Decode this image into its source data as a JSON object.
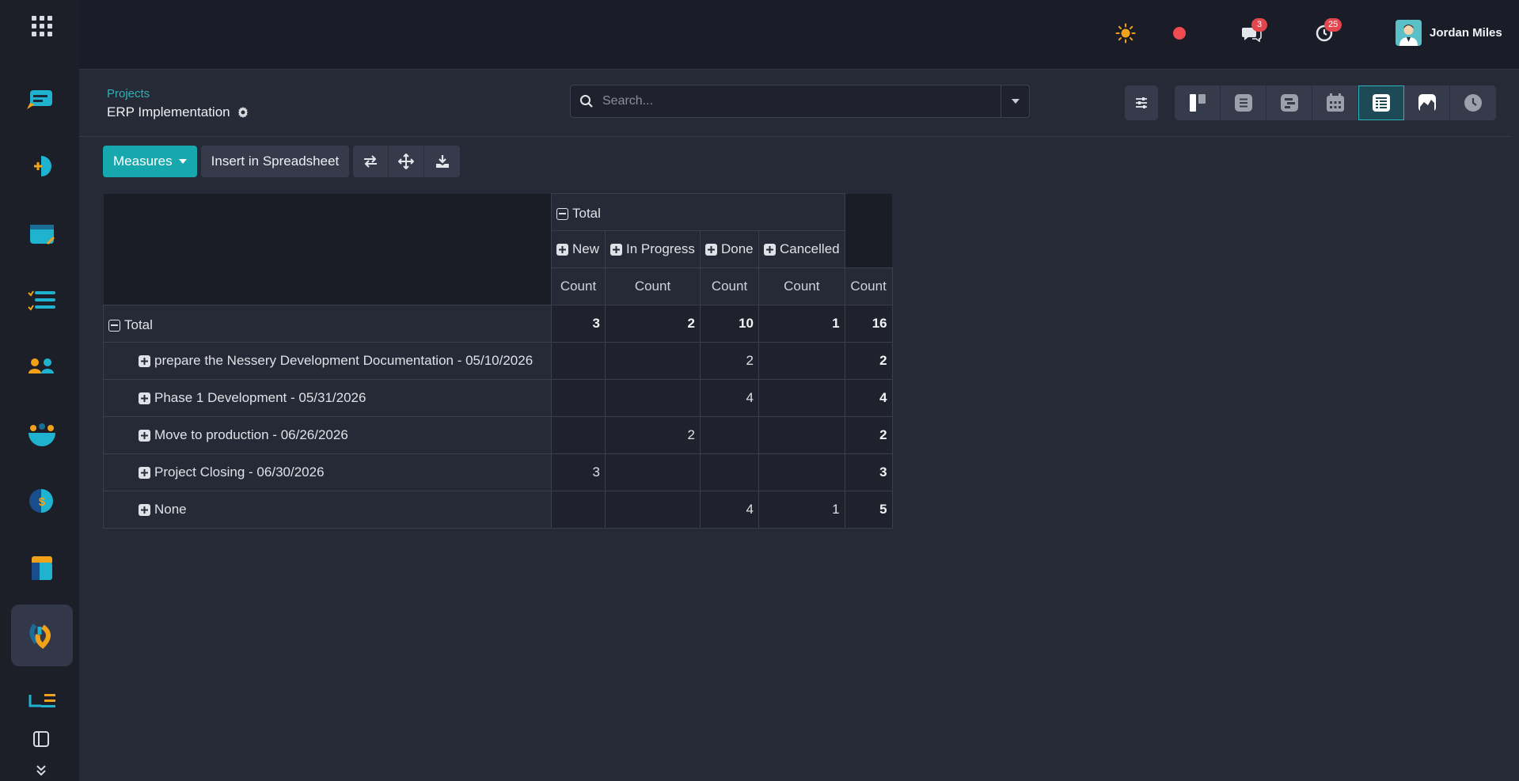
{
  "topbar": {
    "chat_badge": "3",
    "activity_badge": "25",
    "user_name": "Jordan Miles"
  },
  "control": {
    "breadcrumb": "Projects",
    "title": "ERP Implementation",
    "search_placeholder": "Search..."
  },
  "toolbar": {
    "measures_label": "Measures",
    "insert_label": "Insert in Spreadsheet"
  },
  "pivot": {
    "col_total_label": "Total",
    "col_groups": [
      "New",
      "In Progress",
      "Done",
      "Cancelled"
    ],
    "measure_label": "Count",
    "row_total_label": "Total",
    "total_row": [
      "3",
      "2",
      "10",
      "1",
      "16"
    ],
    "rows": [
      {
        "label": "prepare the Nessery Development Documentation - 05/10/2026",
        "values": [
          "",
          "",
          "2",
          "",
          "2"
        ]
      },
      {
        "label": "Phase 1 Development - 05/31/2026",
        "values": [
          "",
          "",
          "4",
          "",
          "4"
        ]
      },
      {
        "label": "Move to production - 06/26/2026",
        "values": [
          "",
          "2",
          "",
          "",
          "2"
        ]
      },
      {
        "label": "Project Closing - 06/30/2026",
        "values": [
          "3",
          "",
          "",
          "",
          "3"
        ]
      },
      {
        "label": "None",
        "values": [
          "",
          "",
          "4",
          "1",
          "5"
        ]
      }
    ]
  },
  "colors": {
    "accent": "#16a8ad",
    "badge": "#e2474e",
    "recording_dot": "#ef4b50",
    "sun": "#f2a218"
  }
}
